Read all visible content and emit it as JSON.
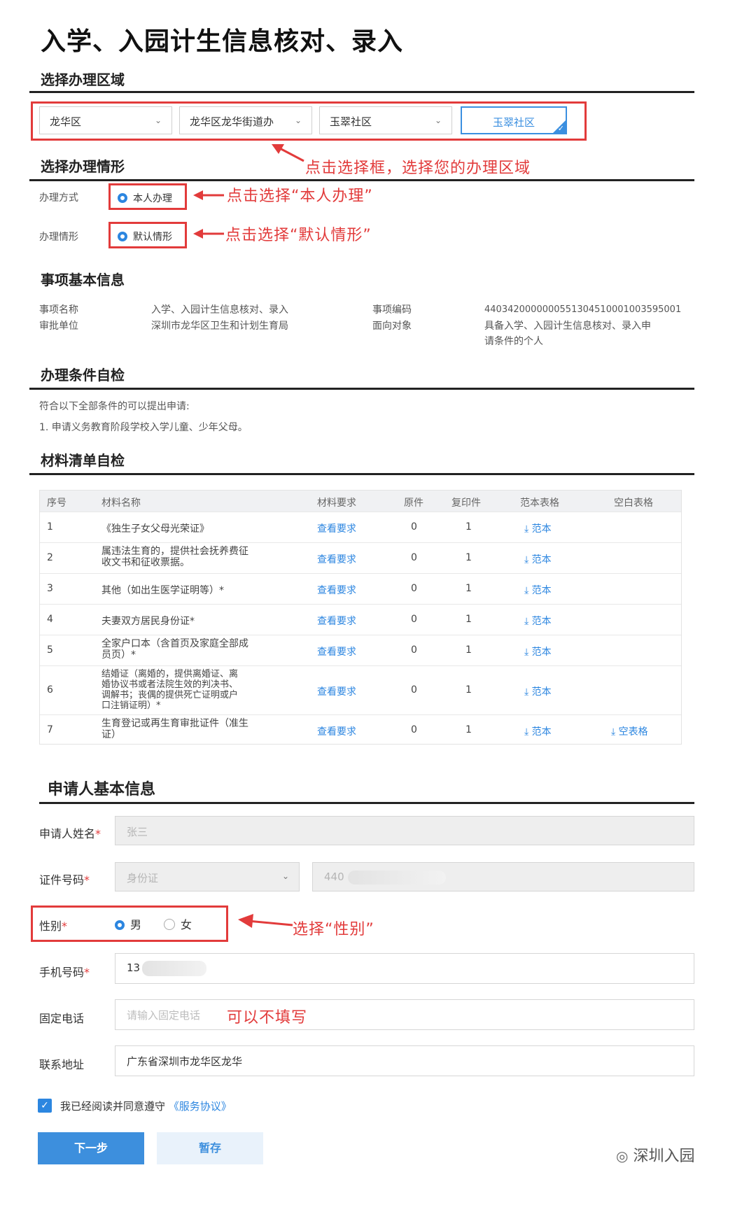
{
  "page": {
    "title": "入学、入园计生信息核对、录入"
  },
  "region": {
    "section_title": "选择办理区域",
    "district": "龙华区",
    "street": "龙华区龙华街道办",
    "community": "玉翠社区",
    "selected_button": "玉翠社区",
    "annotation": "点击选择框，选择您的办理区域"
  },
  "situation": {
    "section_title": "选择办理情形",
    "method_label": "办理方式",
    "method_option": "本人办理",
    "method_annotation": "点击选择“本人办理”",
    "case_label": "办理情形",
    "case_option": "默认情形",
    "case_annotation": "点击选择“默认情形”"
  },
  "basic_info": {
    "section_title": "事项基本信息",
    "name_label": "事项名称",
    "name_value": "入学、入园计生信息核对、录入",
    "dept_label": "审批单位",
    "dept_value": "深圳市龙华区卫生和计划生育局",
    "code_label": "事项编码",
    "code_value": "440342000000055130451000100359500​1",
    "target_label": "面向对象",
    "target_value_1": "具备入学、入园计生信息核对、录入申",
    "target_value_2": "请条件的个人"
  },
  "conditions": {
    "section_title": "办理条件自检",
    "intro": "符合以下全部条件的可以提出申请:",
    "item_1": "1. 申请义务教育阶段学校入学儿童、少年父母。"
  },
  "materials": {
    "section_title": "材料清单自检",
    "headers": {
      "no": "序号",
      "name": "材料名称",
      "req": "材料要求",
      "orig": "原件",
      "copy": "复印件",
      "sample": "范本表格",
      "blank": "空白表格"
    },
    "rows": [
      {
        "no": "1",
        "name_1": "《独生子女父母光荣证》",
        "name_2": "",
        "req": "查看要求",
        "orig": "0",
        "copy": "1",
        "sample": "范本",
        "blank": ""
      },
      {
        "no": "2",
        "name_1": "属违法生育的，提供社会抚养费征",
        "name_2": "收文书和征收票据。",
        "req": "查看要求",
        "orig": "0",
        "copy": "1",
        "sample": "范本",
        "blank": ""
      },
      {
        "no": "3",
        "name_1": "其他（如出生医学证明等）*",
        "name_2": "",
        "req": "查看要求",
        "orig": "0",
        "copy": "1",
        "sample": "范本",
        "blank": ""
      },
      {
        "no": "4",
        "name_1": "夫妻双方居民身份证*",
        "name_2": "",
        "req": "查看要求",
        "orig": "0",
        "copy": "1",
        "sample": "范本",
        "blank": ""
      },
      {
        "no": "5",
        "name_1": "全家户口本（含首页及家庭全部成",
        "name_2": "员页）*",
        "req": "查看要求",
        "orig": "0",
        "copy": "1",
        "sample": "范本",
        "blank": ""
      },
      {
        "no": "6",
        "name_1": "结婚证（离婚的，提供离婚证、离",
        "name_2": "婚协议书或者法院生效的判决书、",
        "name_3": "调解书；丧偶的提供死亡证明或户",
        "name_4": "口注销证明）*",
        "req": "查看要求",
        "orig": "0",
        "copy": "1",
        "sample": "范本",
        "blank": ""
      },
      {
        "no": "7",
        "name_1": "生育登记或再生育审批证件（准生",
        "name_2": "证）",
        "req": "查看要求",
        "orig": "0",
        "copy": "1",
        "sample": "范本",
        "blank": "空表格"
      }
    ]
  },
  "applicant": {
    "section_title": "申请人基本信息",
    "name_label": "申请人姓名",
    "name_value": "张三",
    "id_label": "证件号码",
    "id_type": "身份证",
    "id_value": "440",
    "gender_label": "性别",
    "gender_male": "男",
    "gender_female": "女",
    "gender_annotation": "选择“性别”",
    "phone_label": "手机号码",
    "phone_value": "13",
    "tel_label": "固定电话",
    "tel_placeholder": "请输入固定电话",
    "tel_annotation": "可以不填写",
    "address_label": "联系地址",
    "address_value": "广东省深圳市龙华区龙华",
    "required_mark": "*"
  },
  "agreement": {
    "text": "我已经阅读并同意遵守",
    "link": "《服务协议》"
  },
  "actions": {
    "next": "下一步",
    "save": "暂存"
  },
  "watermark": {
    "text": "深圳入园"
  },
  "colors": {
    "accent": "#2c86e0",
    "annotation": "#e23b3b"
  }
}
